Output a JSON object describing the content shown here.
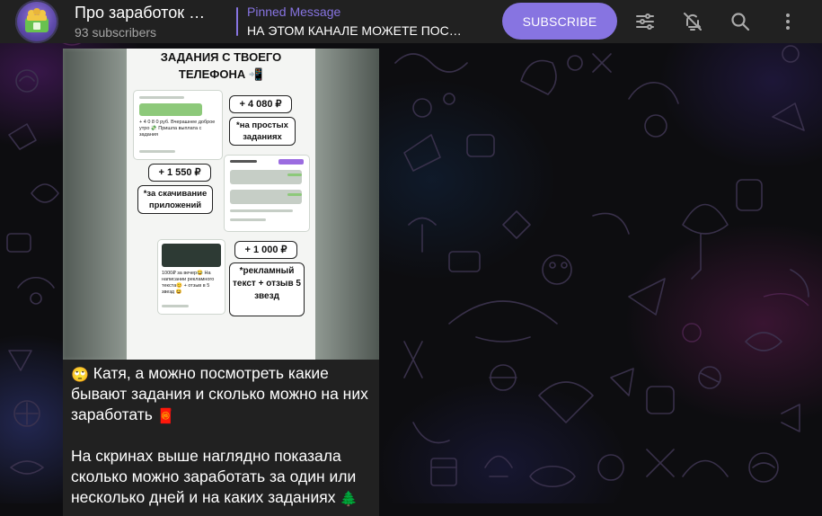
{
  "header": {
    "channel_title": "Про заработок …",
    "subscribers": "93 subscribers",
    "pinned_label": "Pinned Message",
    "pinned_text": "НА ЭТОМ КАНАЛЕ МОЖЕТЕ ПОС…",
    "subscribe_label": "SUBSCRIBE",
    "icons": [
      "sliders-icon",
      "bell-off-icon",
      "search-icon",
      "more-vertical-icon"
    ]
  },
  "message": {
    "media": {
      "heading_line1": "ЗАДАНИЯ С ТВОЕГО",
      "heading_line2": "ТЕЛЕФОНА 📲",
      "amount1": "+ 4 080 ₽",
      "note1": "*на простых заданиях",
      "amount2": "+ 1 550 ₽",
      "note2": "*за скачивание приложений",
      "amount3": "+ 1 000 ₽",
      "note3": "*рекламный текст + отзыв 5 звезд",
      "card1_text": "+ 4 0 8 0 руб. Вчерашнее доброе утро 💸 Пришла выплата с задания",
      "card3_text": "1000₽ за вечер😂 На написании рекламного текста😊 + отзыв в 5 звезд 😆"
    },
    "paragraph1": "Катя, а можно посмотреть какие бывают задания и сколько можно на них заработать",
    "paragraph1_emoji_start": "🙄",
    "paragraph1_emoji_end": "🧧",
    "paragraph2": "На скринах выше наглядно показала сколько можно заработать за один или несколько дней и на каких заданиях",
    "paragraph2_emoji_end": "🌲"
  },
  "colors": {
    "accent": "#8774e1",
    "header_bg": "#212121",
    "bubble_bg": "#212121",
    "subtitle": "#a5a5a5"
  }
}
